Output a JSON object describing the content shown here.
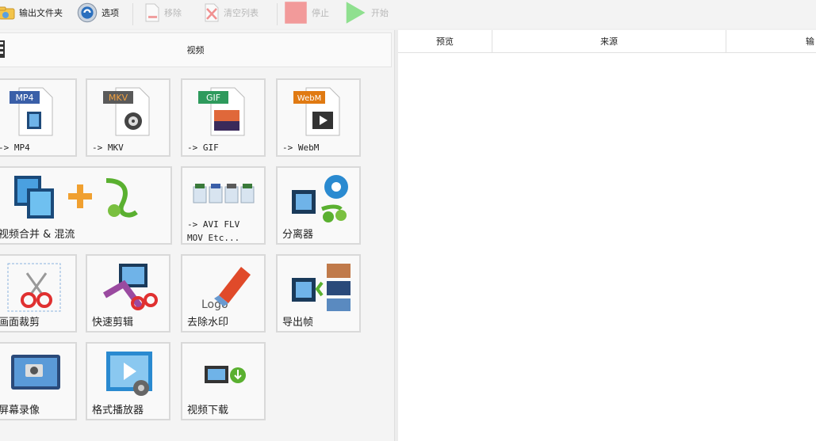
{
  "toolbar": {
    "output_folder": "输出文件夹",
    "options": "选项",
    "remove": "移除",
    "clear_list": "清空列表",
    "stop": "停止",
    "start": "开始"
  },
  "category": {
    "title": "视频"
  },
  "tiles": {
    "mp4": "-> MP4",
    "mkv": "-> MKV",
    "gif": "-> GIF",
    "webm": "-> WebM",
    "mp4_badge": "MP4",
    "mkv_badge": "MKV",
    "gif_badge": "GIF",
    "webm_badge": "WebM",
    "merge": "视频合并 & 混流",
    "avi_line1": "-> AVI FLV",
    "avi_line2": "MOV Etc...",
    "splitter": "分离器",
    "crop": "画面裁剪",
    "quick_cut": "快速剪辑",
    "watermark": "去除水印",
    "watermark_logo": "Logo",
    "export_frames": "导出帧",
    "screen_record": "屏幕录像",
    "player": "格式播放器",
    "downloader": "视频下载"
  },
  "task_list": {
    "columns": [
      "预览",
      "来源",
      "输"
    ]
  },
  "colors": {
    "mp4_badge": "#3a5fa8",
    "mkv_badge": "#5a5a5a",
    "gif_badge": "#2e9a5c",
    "webm_badge": "#e07a12",
    "start_green": "#5fd45f",
    "stop_red": "#f06e6e"
  }
}
